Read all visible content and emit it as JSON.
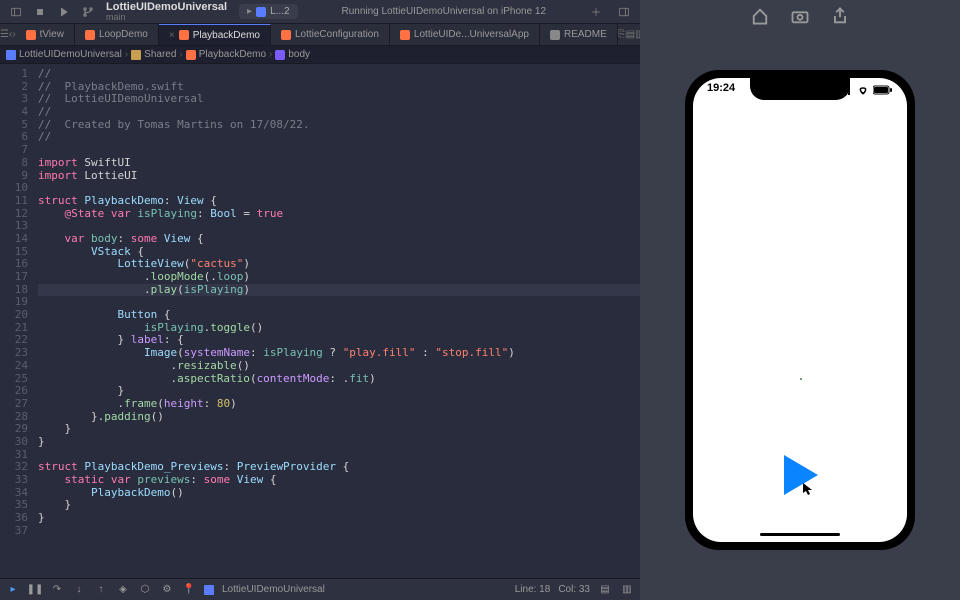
{
  "toolbar": {
    "project_name": "LottieUIDemoUniversal",
    "branch": "main",
    "scheme": "L...2",
    "status": "Running LottieUIDemoUniversal on iPhone 12"
  },
  "tabs": [
    {
      "label": "tView",
      "active": false
    },
    {
      "label": "LoopDemo",
      "active": false
    },
    {
      "label": "PlaybackDemo",
      "active": true
    },
    {
      "label": "LottieConfiguration",
      "active": false
    },
    {
      "label": "LottieUIDe...UniversalApp",
      "active": false
    },
    {
      "label": "README",
      "active": false,
      "md": true
    }
  ],
  "breadcrumb": {
    "parts": [
      "LottieUIDemoUniversal",
      "Shared",
      "PlaybackDemo",
      "body"
    ]
  },
  "code": {
    "lines": [
      {
        "n": 1,
        "t": "//",
        "c": "comment"
      },
      {
        "n": 2,
        "t": "//  PlaybackDemo.swift",
        "c": "comment"
      },
      {
        "n": 3,
        "t": "//  LottieUIDemoUniversal",
        "c": "comment"
      },
      {
        "n": 4,
        "t": "//",
        "c": "comment"
      },
      {
        "n": 5,
        "t": "//  Created by Tomas Martins on 17/08/22.",
        "c": "comment"
      },
      {
        "n": 6,
        "t": "//",
        "c": "comment"
      },
      {
        "n": 7,
        "t": "",
        "c": ""
      },
      {
        "n": 8,
        "html": "<span class='tok-keyword'>import</span> <span class='tok-id'>SwiftUI</span>"
      },
      {
        "n": 9,
        "html": "<span class='tok-keyword'>import</span> <span class='tok-id'>LottieUI</span>"
      },
      {
        "n": 10,
        "t": "",
        "c": ""
      },
      {
        "n": 11,
        "html": "<span class='tok-keyword'>struct</span> <span class='tok-type'>PlaybackDemo</span>: <span class='tok-type'>View</span> {"
      },
      {
        "n": 12,
        "html": "    <span class='tok-keyword'>@State</span> <span class='tok-keyword'>var</span> <span class='tok-prop'>isPlaying</span>: <span class='tok-type'>Bool</span> = <span class='tok-keyword'>true</span>"
      },
      {
        "n": 13,
        "t": "    ",
        "c": ""
      },
      {
        "n": 14,
        "html": "    <span class='tok-keyword'>var</span> <span class='tok-prop'>body</span>: <span class='tok-keyword'>some</span> <span class='tok-type'>View</span> {"
      },
      {
        "n": 15,
        "html": "        <span class='tok-type'>VStack</span> {"
      },
      {
        "n": 16,
        "html": "            <span class='tok-type'>LottieView</span>(<span class='tok-string'>\"cactus\"</span>)"
      },
      {
        "n": 17,
        "html": "                .<span class='tok-func'>loopMode</span>(.<span class='tok-prop'>loop</span>)"
      },
      {
        "n": 18,
        "html": "                .<span class='tok-func'>play</span>(<span class='tok-prop'>isPlaying</span>)",
        "hl": true
      },
      {
        "n": 19,
        "t": "",
        "c": ""
      },
      {
        "n": 20,
        "html": "            <span class='tok-type'>Button</span> {"
      },
      {
        "n": 21,
        "html": "                <span class='tok-prop'>isPlaying</span>.<span class='tok-func'>toggle</span>()"
      },
      {
        "n": 22,
        "html": "            } <span class='tok-attr'>label</span>: {"
      },
      {
        "n": 23,
        "html": "                <span class='tok-type'>Image</span>(<span class='tok-attr'>systemName</span>: <span class='tok-prop'>isPlaying</span> ? <span class='tok-string'>\"play.fill\"</span> : <span class='tok-string'>\"stop.fill\"</span>)"
      },
      {
        "n": 24,
        "html": "                    .<span class='tok-func'>resizable</span>()"
      },
      {
        "n": 25,
        "html": "                    .<span class='tok-func'>aspectRatio</span>(<span class='tok-attr'>contentMode</span>: .<span class='tok-prop'>fit</span>)"
      },
      {
        "n": 26,
        "html": "            }"
      },
      {
        "n": 27,
        "html": "            .<span class='tok-func'>frame</span>(<span class='tok-attr'>height</span>: <span class='tok-num'>80</span>)"
      },
      {
        "n": 28,
        "html": "        }.<span class='tok-func'>padding</span>()"
      },
      {
        "n": 29,
        "html": "    }"
      },
      {
        "n": 30,
        "html": "}"
      },
      {
        "n": 31,
        "t": "",
        "c": ""
      },
      {
        "n": 32,
        "html": "<span class='tok-keyword'>struct</span> <span class='tok-type'>PlaybackDemo_Previews</span>: <span class='tok-type'>PreviewProvider</span> {"
      },
      {
        "n": 33,
        "html": "    <span class='tok-keyword'>static</span> <span class='tok-keyword'>var</span> <span class='tok-prop'>previews</span>: <span class='tok-keyword'>some</span> <span class='tok-type'>View</span> {"
      },
      {
        "n": 34,
        "html": "        <span class='tok-type'>PlaybackDemo</span>()"
      },
      {
        "n": 35,
        "html": "    }"
      },
      {
        "n": 36,
        "html": "}"
      },
      {
        "n": 37,
        "t": "",
        "c": ""
      }
    ]
  },
  "debugbar": {
    "target": "LottieUIDemoUniversal"
  },
  "statusbar_footer": {
    "line": "Line: 18",
    "col": "Col: 33"
  },
  "simulator": {
    "time": "19:24"
  }
}
